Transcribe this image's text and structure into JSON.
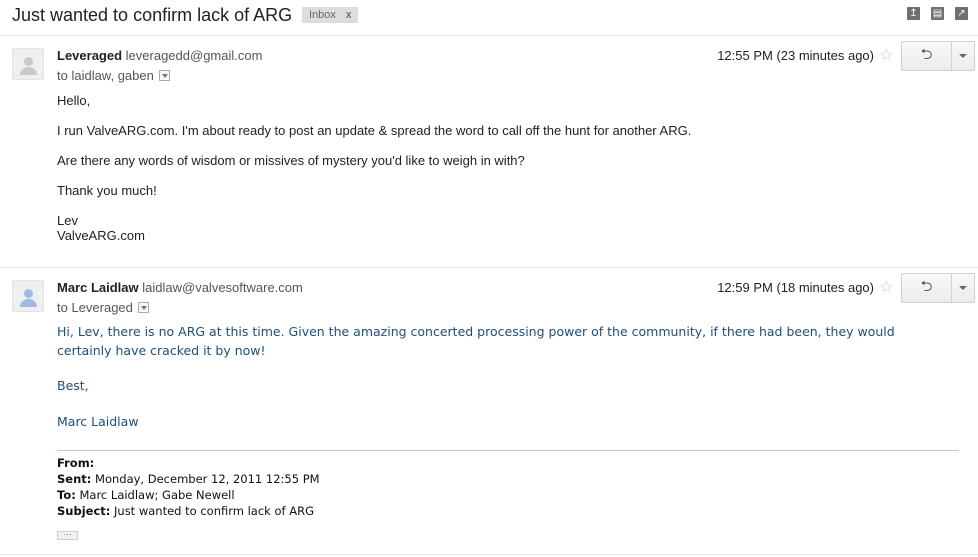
{
  "thread": {
    "subject": "Just wanted to confirm lack of ARG",
    "label": "Inbox",
    "label_remove": "x",
    "toolbar_icons": [
      "archive-icon",
      "print-icon",
      "new-window-icon"
    ]
  },
  "messages": [
    {
      "sender_name": "Leveraged",
      "sender_email": "leveragedd@gmail.com",
      "to": "to laidlaw, gaben",
      "time": "12:55 PM (23 minutes ago)",
      "body": [
        "Hello,",
        "I run ValveARG.com. I'm about ready to post an update & spread the word to call off the hunt for another ARG.",
        "Are there any words of wisdom or missives of mystery you'd like to weigh in with?",
        "Thank you much!",
        "Lev",
        "ValveARG.com"
      ]
    },
    {
      "sender_name": "Marc Laidlaw",
      "sender_email": "laidlaw@valvesoftware.com",
      "to": "to Leveraged",
      "time": "12:59 PM (18 minutes ago)",
      "body": [
        "Hi, Lev, there is no ARG at this time. Given the amazing concerted processing power of the community, if there had been, they would certainly have cracked it by now!",
        "Best,",
        "Marc Laidlaw"
      ],
      "quoted": {
        "from_label": "From:",
        "from_value": "",
        "sent_label": "Sent:",
        "sent_value": "Monday, December 12, 2011 12:55 PM",
        "to_label": "To:",
        "to_value": "Marc Laidlaw; Gabe Newell",
        "subject_label": "Subject:",
        "subject_value": "Just wanted to confirm lack of ARG"
      },
      "show_trimmed": "···"
    }
  ],
  "reply_glyph": "⮌",
  "star_glyph": "☆"
}
